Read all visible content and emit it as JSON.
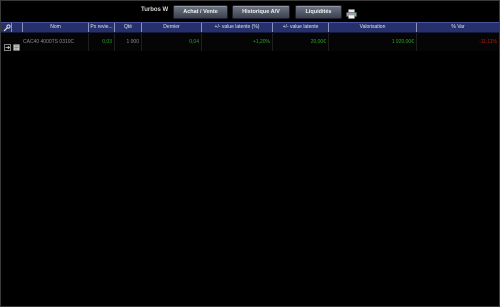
{
  "toolbar": {
    "title": "Turbos W",
    "buttons": {
      "achat_vente": "Achat / Vente",
      "historique": "Historique A/V",
      "liquidites": "Liquidités"
    }
  },
  "table": {
    "headers": {
      "nom": "Nom",
      "px_revient": "Px revie...",
      "qte": "Qté",
      "dernier": "Dernier",
      "pv_latente_pct": "+/- value latente (%)",
      "pv_latente": "+/- value latente",
      "valorisation": "Valorisation",
      "var_pct": "% Var"
    },
    "rows": [
      {
        "nom": "CAC40 4000TS 0310C",
        "px_revient": "0,03",
        "qte": "1 000",
        "dernier": "0,04",
        "pv_latente_pct": "+1,20%",
        "pv_latente": "20,00€",
        "valorisation": "1 920,00€",
        "var_pct": "-11,11%"
      }
    ]
  },
  "colors": {
    "header_bg": "#26306c",
    "positive": "#28a828",
    "negative": "#b81c1c"
  }
}
